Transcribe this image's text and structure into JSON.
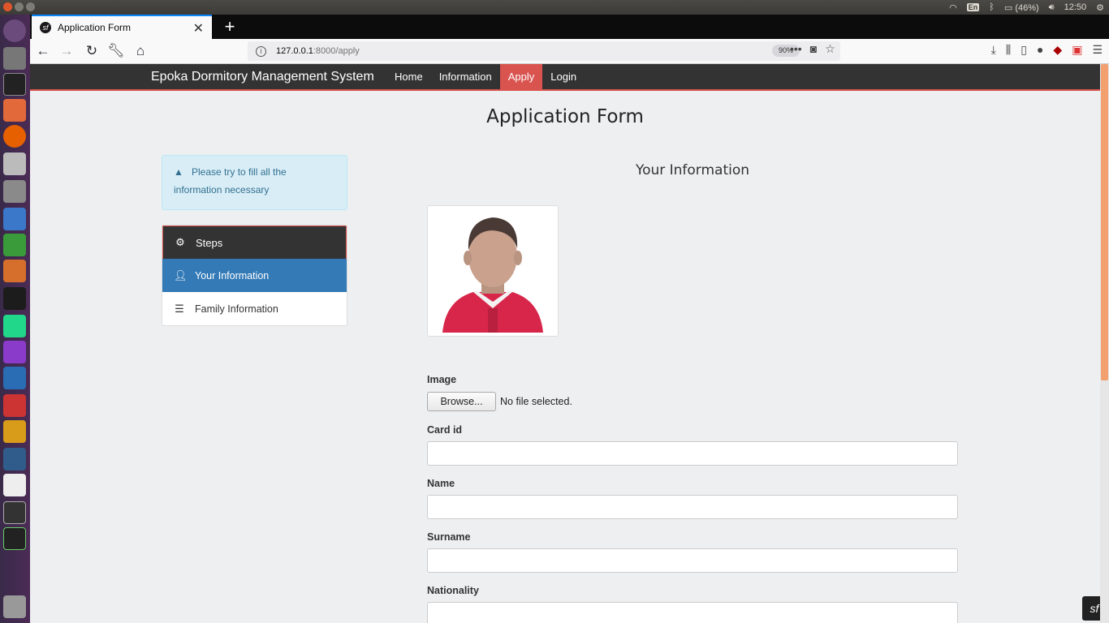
{
  "system": {
    "keyboard_layout": "En",
    "battery": "(46%)",
    "clock": "12:50"
  },
  "browser": {
    "tab_title": "Application Form",
    "url_host": "127.0.0.1",
    "url_path": ":8000/apply",
    "zoom": "90%"
  },
  "app": {
    "brand": "Epoka Dormitory Management System",
    "menu": [
      "Home",
      "Information",
      "Apply",
      "Login"
    ],
    "active_menu": "Apply"
  },
  "page": {
    "title": "Application Form",
    "alert": "Please try to fill all the information necessary",
    "steps_header": "Steps",
    "steps": [
      "Your Information",
      "Family Information"
    ],
    "section_title": "Your Information"
  },
  "form": {
    "image_label": "Image",
    "browse_label": "Browse...",
    "no_file": "No file selected.",
    "card_id_label": "Card id",
    "name_label": "Name",
    "surname_label": "Surname",
    "nationality_label": "Nationality"
  },
  "icons": {
    "tab_favicon": "symfony-icon",
    "alert_icon": "warning-icon",
    "steps_icon": "gear-icon",
    "your_info_icon": "user-icon",
    "family_icon": "list-icon"
  },
  "colors": {
    "navbar": "#333333",
    "active_menu": "#d9534f",
    "active_step": "#337ab7",
    "alert_bg": "#d9edf7"
  }
}
